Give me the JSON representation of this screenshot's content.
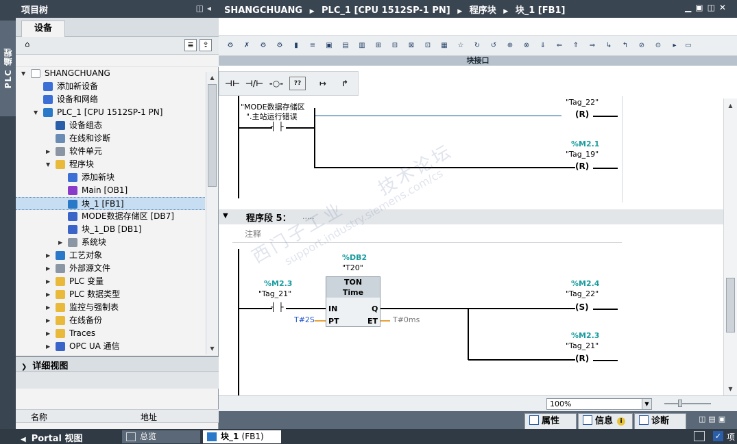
{
  "left_strip": {
    "tab_label": "PLC 编程"
  },
  "project_tree": {
    "title": "项目树",
    "tab": "设备",
    "items": [
      {
        "label": "SHANGCHUANG",
        "level": 0,
        "twisty": "▼",
        "icon": "project-icon",
        "color": "#ffffff"
      },
      {
        "label": "添加新设备",
        "level": 1,
        "twisty": "",
        "icon": "add-device-icon",
        "color": "#3b6fd6"
      },
      {
        "label": "设备和网络",
        "level": 1,
        "twisty": "",
        "icon": "network-icon",
        "color": "#3b6fd6"
      },
      {
        "label": "PLC_1 [CPU 1512SP-1 PN]",
        "level": 1,
        "twisty": "▼",
        "icon": "plc-icon",
        "color": "#2a78c8"
      },
      {
        "label": "设备组态",
        "level": 2,
        "twisty": "",
        "icon": "device-config-icon",
        "color": "#2a5ea8"
      },
      {
        "label": "在线和诊断",
        "level": 2,
        "twisty": "",
        "icon": "online-diag-icon",
        "color": "#6a8cb4"
      },
      {
        "label": "软件单元",
        "level": 2,
        "twisty": "▶",
        "icon": "software-unit-icon",
        "color": "#8a96a3"
      },
      {
        "label": "程序块",
        "level": 2,
        "twisty": "▼",
        "icon": "folder-icon",
        "color": "#e8b93a"
      },
      {
        "label": "添加新块",
        "level": 3,
        "twisty": "",
        "icon": "add-block-icon",
        "color": "#3b6fd6"
      },
      {
        "label": "Main [OB1]",
        "level": 3,
        "twisty": "",
        "icon": "ob-block-icon",
        "color": "#8a3ac8"
      },
      {
        "label": "块_1 [FB1]",
        "level": 3,
        "twisty": "",
        "icon": "fb-block-icon",
        "color": "#2a78c8",
        "selected": true
      },
      {
        "label": "MODE数据存储区 [DB7]",
        "level": 3,
        "twisty": "",
        "icon": "db-block-icon",
        "color": "#3a64c8"
      },
      {
        "label": "块_1_DB [DB1]",
        "level": 3,
        "twisty": "",
        "icon": "db-block-icon",
        "color": "#3a64c8"
      },
      {
        "label": "系统块",
        "level": 3,
        "twisty": "▶",
        "icon": "system-block-icon",
        "color": "#8a96a3"
      },
      {
        "label": "工艺对象",
        "level": 2,
        "twisty": "▶",
        "icon": "technology-object-icon",
        "color": "#2a78c8"
      },
      {
        "label": "外部源文件",
        "level": 2,
        "twisty": "▶",
        "icon": "external-source-icon",
        "color": "#8a96a3"
      },
      {
        "label": "PLC 变量",
        "level": 2,
        "twisty": "▶",
        "icon": "plc-tags-icon",
        "color": "#e8b93a"
      },
      {
        "label": "PLC 数据类型",
        "level": 2,
        "twisty": "▶",
        "icon": "plc-datatype-icon",
        "color": "#e8b93a"
      },
      {
        "label": "监控与强制表",
        "level": 2,
        "twisty": "▶",
        "icon": "watch-table-icon",
        "color": "#e8b93a"
      },
      {
        "label": "在线备份",
        "level": 2,
        "twisty": "▶",
        "icon": "online-backup-icon",
        "color": "#e8b93a"
      },
      {
        "label": "Traces",
        "level": 2,
        "twisty": "▶",
        "icon": "traces-icon",
        "color": "#e8b93a"
      },
      {
        "label": "OPC UA 通信",
        "level": 2,
        "twisty": "▶",
        "icon": "opcua-icon",
        "color": "#3a64c8"
      }
    ]
  },
  "details_view": {
    "title": "详细视图",
    "columns": [
      "名称",
      "地址"
    ]
  },
  "editor": {
    "breadcrumb": [
      "SHANGCHUANG",
      "PLC_1 [CPU 1512SP-1 PN]",
      "程序块",
      "块_1 [FB1]"
    ],
    "interface_label": "块接口",
    "zoom": "100%",
    "network4": {
      "contact_comment": [
        "\"MODE数据存储区",
        "\".主站运行错误"
      ],
      "coil1_tag": "\"Tag_22\"",
      "coil2_addr": "%M2.1",
      "coil2_tag": "\"Tag_19\"",
      "coil_reset": "R"
    },
    "network5": {
      "title": "程序段 5：",
      "title_dots": ".....",
      "comment": "注释",
      "timer_db_addr": "%DB2",
      "timer_db_name": "\"T20\"",
      "timer_type": "TON",
      "timer_subtype": "Time",
      "pin_in": "IN",
      "pin_q": "Q",
      "pin_pt": "PT",
      "pin_et": "ET",
      "pt_value": "T#2S",
      "et_value": "T#0ms",
      "contact_addr": "%M2.3",
      "contact_tag": "\"Tag_21\"",
      "coil1_addr": "%M2.4",
      "coil1_tag": "\"Tag_22\"",
      "coil1_type": "S",
      "coil2_addr": "%M2.3",
      "coil2_tag": "\"Tag_21\"",
      "coil2_type": "R"
    }
  },
  "watermark": [
    "西门子工业",
    "技术论坛",
    "support.industry.siemens.com/cs"
  ],
  "properties_bar": {
    "tabs": [
      "属性",
      "信息",
      "诊断"
    ]
  },
  "status_bar": {
    "portal": "Portal 视图",
    "tabs": [
      "总览",
      "块_1",
      "(FB1)"
    ],
    "right_label": "项"
  }
}
